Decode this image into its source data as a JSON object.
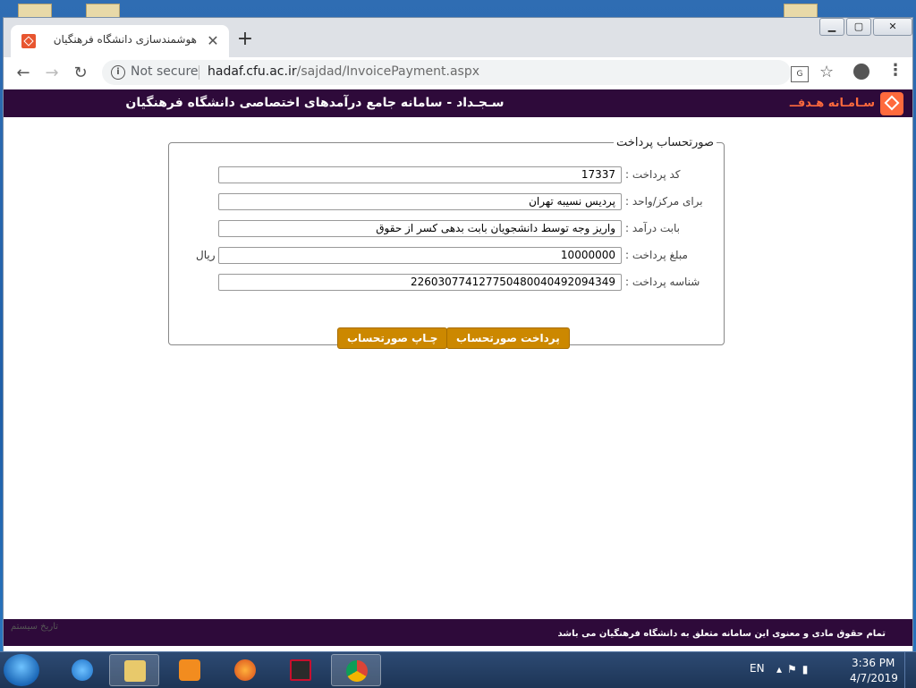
{
  "browser": {
    "tab_title": "هوشمندسازی دانشگاه فرهنگیان",
    "new_tab": "+",
    "close_tab": "✕",
    "security": "Not secure",
    "url_host": "hadaf.cfu.ac.ir",
    "url_path": "/sajdad/InvoicePayment.aspx"
  },
  "header": {
    "title": "سـجـداد - سامانه جامع درآمدهای اختصاصی دانشگاه فرهنگیان",
    "logo_text": "سـامـانه هـدفــ"
  },
  "form": {
    "legend": "صورتحساب پرداخت",
    "fields": [
      {
        "label": "کد پرداخت :",
        "value": "17337"
      },
      {
        "label": "برای مرکز/واحد :",
        "value": "پردیس نسیبه تهران"
      },
      {
        "label": "بابت درآمد :",
        "value": "واریز وجه توسط دانشجویان بابت بدهی کسر از حقوق"
      },
      {
        "label": "مبلغ پرداخت :",
        "value": "10000000",
        "unit": "ریال"
      },
      {
        "label": "شناسه پرداخت :",
        "value": "2260307741277504800404920943​49"
      }
    ],
    "pay_button": "پرداخت صورتحساب",
    "print_button": "چـاپ صورتحساب"
  },
  "footer": {
    "copyright": "تمام حقوق مادی و معنوی این سامانه متعلق به دانشگاه فرهنگیان می باشد",
    "left_text": "تاریخ سیستم"
  },
  "taskbar": {
    "lang": "EN",
    "time": "3:36 PM",
    "date": "4/7/2019"
  }
}
